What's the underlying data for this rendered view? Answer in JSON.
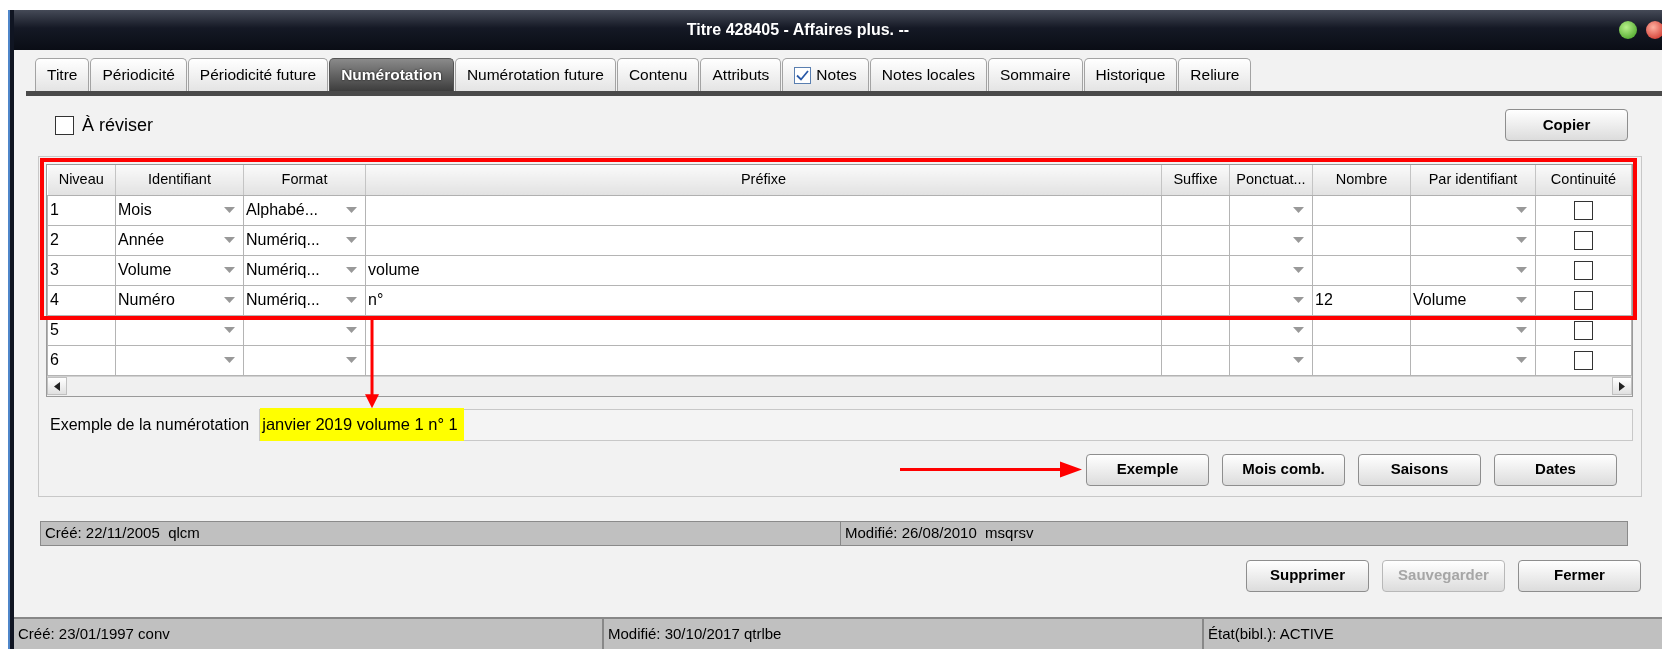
{
  "window": {
    "title": "Titre 428405 - Affaires plus. --"
  },
  "tabs": [
    {
      "label": "Titre",
      "selected": false
    },
    {
      "label": "Périodicité",
      "selected": false
    },
    {
      "label": "Périodicité future",
      "selected": false
    },
    {
      "label": "Numérotation",
      "selected": true
    },
    {
      "label": "Numérotation future",
      "selected": false
    },
    {
      "label": "Contenu",
      "selected": false
    },
    {
      "label": "Attributs",
      "selected": false
    },
    {
      "label": "Notes",
      "selected": false,
      "checked": true
    },
    {
      "label": "Notes locales",
      "selected": false
    },
    {
      "label": "Sommaire",
      "selected": false
    },
    {
      "label": "Historique",
      "selected": false
    },
    {
      "label": "Reliure",
      "selected": false
    }
  ],
  "revise": {
    "label": "À réviser",
    "checked": false
  },
  "copy_button": {
    "label": "Copier"
  },
  "table": {
    "columns": [
      {
        "label": "Niveau",
        "kind": "text"
      },
      {
        "label": "Identifiant",
        "kind": "combo"
      },
      {
        "label": "Format",
        "kind": "combo"
      },
      {
        "label": "Préfixe",
        "kind": "text"
      },
      {
        "label": "Suffixe",
        "kind": "text"
      },
      {
        "label": "Ponctuat...",
        "kind": "combo"
      },
      {
        "label": "Nombre",
        "kind": "text"
      },
      {
        "label": "Par identifiant",
        "kind": "combo"
      },
      {
        "label": "Continuité",
        "kind": "check"
      }
    ],
    "rows": [
      {
        "cells": [
          "1",
          "Mois",
          "Alphabé...",
          null,
          null,
          null,
          null,
          null,
          false
        ]
      },
      {
        "cells": [
          "2",
          "Année",
          "Numériq...",
          null,
          null,
          null,
          null,
          null,
          false
        ]
      },
      {
        "cells": [
          "3",
          "Volume",
          "Numériq...",
          "volume",
          null,
          null,
          null,
          null,
          false
        ]
      },
      {
        "cells": [
          "4",
          "Numéro",
          "Numériq...",
          "n°",
          null,
          null,
          "12",
          "Volume",
          false
        ]
      },
      {
        "cells": [
          "5",
          null,
          null,
          null,
          null,
          null,
          null,
          null,
          false
        ]
      },
      {
        "cells": [
          "6",
          null,
          null,
          null,
          null,
          null,
          null,
          null,
          false
        ]
      }
    ]
  },
  "example": {
    "label": "Exemple de la numérotation",
    "value": "janvier 2019 volume 1 n° 1",
    "highlighted": true
  },
  "panel_buttons": [
    {
      "label": "Exemple"
    },
    {
      "label": "Mois comb."
    },
    {
      "label": "Saisons"
    },
    {
      "label": "Dates"
    }
  ],
  "record_status": [
    "Créé: 22/11/2005  qlcm",
    "Modifié: 26/08/2010  msqrsv"
  ],
  "dialog_buttons": [
    {
      "label": "Supprimer",
      "disabled": false
    },
    {
      "label": "Sauvegarder",
      "disabled": true
    },
    {
      "label": "Fermer",
      "disabled": false
    }
  ],
  "status_bar": [
    "Créé: 23/01/1997 conv",
    "Modifié: 30/10/2017 qtrlbe",
    "État(bibl.): ACTIVE"
  ],
  "annotations": [
    {
      "kind": "frame"
    },
    {
      "kind": "arrow-down"
    },
    {
      "kind": "arrow-right"
    }
  ]
}
